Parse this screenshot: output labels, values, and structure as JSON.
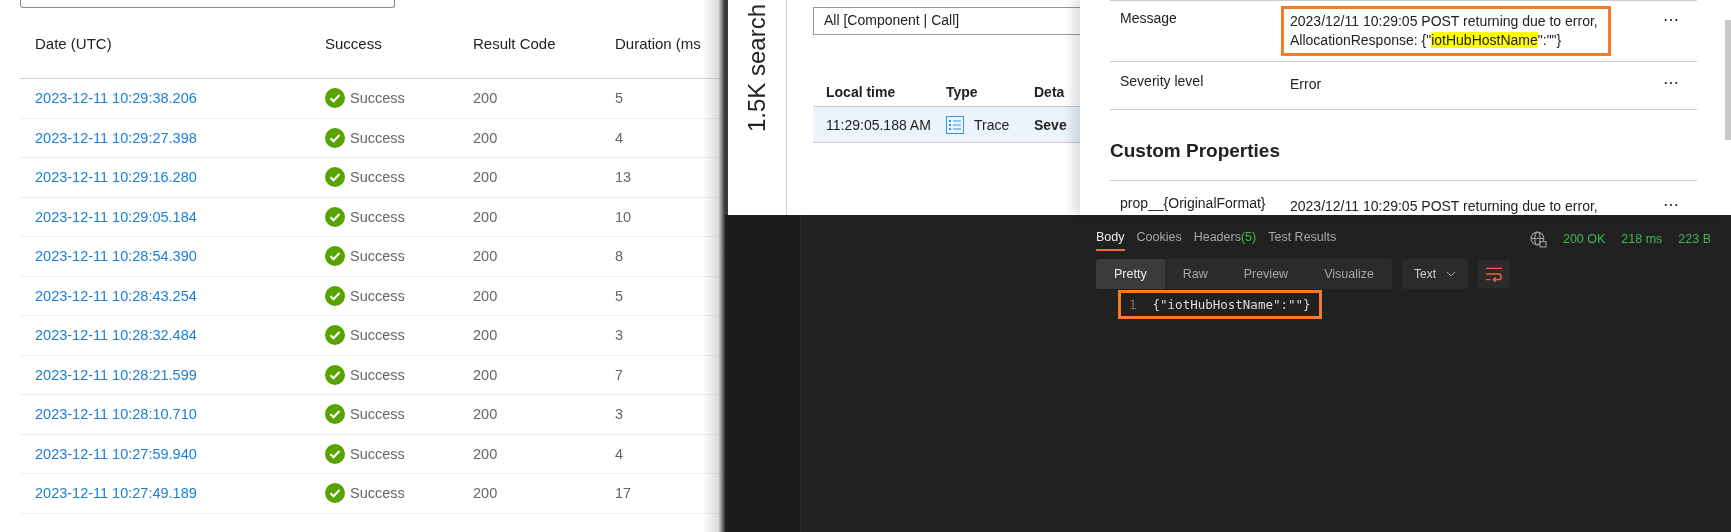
{
  "requests": {
    "columns": [
      "Date (UTC)",
      "Success",
      "Result Code",
      "Duration (ms"
    ],
    "rows": [
      {
        "date": "2023-12-11 10:29:38.206",
        "success": "Success",
        "code": "200",
        "duration": "5"
      },
      {
        "date": "2023-12-11 10:29:27.398",
        "success": "Success",
        "code": "200",
        "duration": "4"
      },
      {
        "date": "2023-12-11 10:29:16.280",
        "success": "Success",
        "code": "200",
        "duration": "13"
      },
      {
        "date": "2023-12-11 10:29:05.184",
        "success": "Success",
        "code": "200",
        "duration": "10"
      },
      {
        "date": "2023-12-11 10:28:54.390",
        "success": "Success",
        "code": "200",
        "duration": "8"
      },
      {
        "date": "2023-12-11 10:28:43.254",
        "success": "Success",
        "code": "200",
        "duration": "5"
      },
      {
        "date": "2023-12-11 10:28:32.484",
        "success": "Success",
        "code": "200",
        "duration": "3"
      },
      {
        "date": "2023-12-11 10:28:21.599",
        "success": "Success",
        "code": "200",
        "duration": "7"
      },
      {
        "date": "2023-12-11 10:28:10.710",
        "success": "Success",
        "code": "200",
        "duration": "3"
      },
      {
        "date": "2023-12-11 10:27:59.940",
        "success": "Success",
        "code": "200",
        "duration": "4"
      },
      {
        "date": "2023-12-11 10:27:49.189",
        "success": "Success",
        "code": "200",
        "duration": "17"
      }
    ]
  },
  "search_panel": {
    "title": "1.5K search",
    "filter": {
      "value": "All [Component | Call]"
    },
    "columns": [
      "Local time",
      "Type",
      "Deta"
    ],
    "rows": [
      {
        "time": "11:29:05.188 AM",
        "type": "Trace",
        "details": "Seve",
        "selected": true
      }
    ]
  },
  "details": {
    "rows": [
      {
        "label": "Message",
        "value": {
          "before": "2023/12/11 10:29:05 POST returning due to error, AllocationResponse: {\"",
          "highlight": "iotHubHostName",
          "after": "\":\"\"}"
        },
        "outlined": true,
        "more": "⋯"
      },
      {
        "label": "Severity level",
        "value": {
          "before": "Error"
        },
        "outlined": false,
        "more": "⋯"
      }
    ],
    "custom_properties": {
      "title": "Custom Properties",
      "rows": [
        {
          "label": "prop__{OriginalFormat}",
          "value": "2023/12/11 10:29:05 POST returning due to error,",
          "more": "⋯"
        }
      ]
    }
  },
  "response": {
    "tabs": [
      {
        "label": "Body",
        "selected": true
      },
      {
        "label": "Cookies",
        "selected": false
      },
      {
        "label": "Headers",
        "count": "(5)",
        "selected": false
      },
      {
        "label": "Test Results",
        "selected": false
      }
    ],
    "status": "200 OK",
    "time": "218 ms",
    "size": "223 B",
    "views": [
      {
        "label": "Pretty",
        "selected": true
      },
      {
        "label": "Raw",
        "selected": false
      },
      {
        "label": "Preview",
        "selected": false
      },
      {
        "label": "Visualize",
        "selected": false
      }
    ],
    "format": "Text",
    "code_outlined": true,
    "lines": [
      {
        "number": "1",
        "code": "{\"iotHubHostName\":\"\"}"
      }
    ]
  }
}
